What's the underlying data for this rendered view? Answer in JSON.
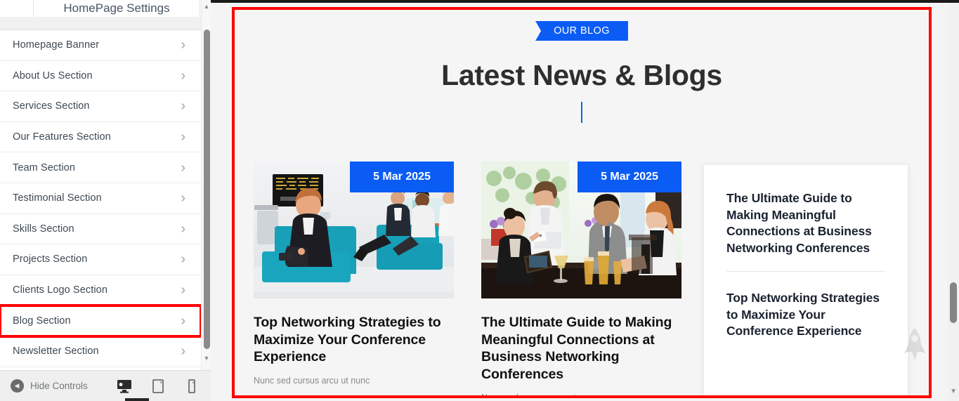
{
  "colors": {
    "accent_blue": "#0b5cf5",
    "highlight_red": "#ff0000",
    "heading_dark": "#2e2e2e",
    "panel_bg": "#f5f5f5"
  },
  "left_panel": {
    "tab_title": "HomePage Settings",
    "sections": [
      {
        "label": "Homepage Banner",
        "chevron": "chevron-right-icon",
        "highlighted": false
      },
      {
        "label": "About Us Section",
        "chevron": "chevron-right-icon",
        "highlighted": false
      },
      {
        "label": "Services Section",
        "chevron": "chevron-right-icon",
        "highlighted": false
      },
      {
        "label": "Our Features Section",
        "chevron": "chevron-right-icon",
        "highlighted": false
      },
      {
        "label": "Team Section",
        "chevron": "chevron-right-icon",
        "highlighted": false
      },
      {
        "label": "Testimonial Section",
        "chevron": "chevron-right-icon",
        "highlighted": false
      },
      {
        "label": "Skills Section",
        "chevron": "chevron-right-icon",
        "highlighted": false
      },
      {
        "label": "Projects Section",
        "chevron": "chevron-right-icon",
        "highlighted": false
      },
      {
        "label": "Clients Logo Section",
        "chevron": "chevron-right-icon",
        "highlighted": false
      },
      {
        "label": "Blog Section",
        "chevron": "chevron-right-icon",
        "highlighted": true
      },
      {
        "label": "Newsletter Section",
        "chevron": "chevron-right-icon",
        "highlighted": false
      }
    ]
  },
  "controls_bar": {
    "hide_controls_label": "Hide Controls",
    "collapse_icon": "caret-left-circle-icon",
    "devices": [
      {
        "name": "desktop-preview",
        "icon": "desktop-icon",
        "active": true
      },
      {
        "name": "tablet-preview",
        "icon": "tablet-icon",
        "active": false
      },
      {
        "name": "mobile-preview",
        "icon": "mobile-icon",
        "active": false
      }
    ]
  },
  "preview": {
    "badge_label": "OUR BLOG",
    "heading": "Latest News & Blogs",
    "cards": [
      {
        "date": "5 Mar 2025",
        "title": "Top Networking Strategies to Maximize Your Conference Experience",
        "meta": "Nunc sed cursus arcu ut nunc",
        "image": "business-people-lounge-photo"
      },
      {
        "date": "5 Mar 2025",
        "title": "The Ultimate Guide to Making Meaningful Connections at Business Networking Conferences",
        "meta": "Nunc sed cursus arcu ut nunc",
        "image": "business-people-restaurant-photo"
      }
    ],
    "recent_panel": {
      "items": [
        {
          "title": "The Ultimate Guide to Making Meaningful Connections at Business Networking Conferences"
        },
        {
          "title": "Top Networking Strategies to Maximize Your Conference Experience"
        }
      ]
    },
    "scroll_top_icon": "rocket-icon"
  }
}
